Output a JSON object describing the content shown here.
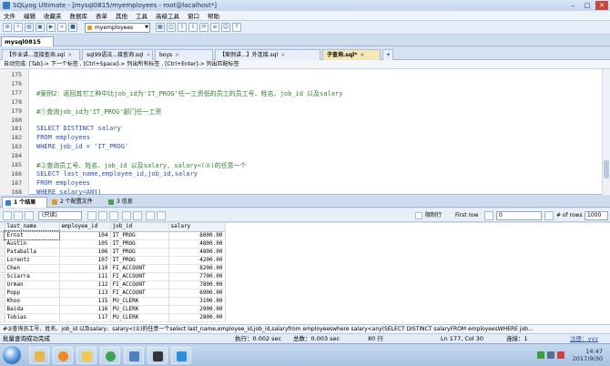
{
  "window": {
    "title": "SQLyog Ultimate - [mysql0815/myemployees - root@localhost*]"
  },
  "menu": [
    "文件",
    "编辑",
    "收藏夹",
    "数据库",
    "表单",
    "其他",
    "工具",
    "高级工具",
    "窗口",
    "帮助"
  ],
  "toolbar": {
    "database_select": "myemployees"
  },
  "connection_tab": "mysql0815",
  "query_tabs": [
    {
      "label": "【作业讲...连接查询.sql",
      "active": false
    },
    {
      "label": "sql99语法...接查询.sql",
      "active": false
    },
    {
      "label": "boys",
      "active": false
    },
    {
      "label": "【案例讲...】外连接.sql",
      "active": false
    },
    {
      "label": "子查询.sql*",
      "active": true
    }
  ],
  "hint": "自动完成: [Tab]-> 下一个标签 , [Ctrl+Space]-> 列出所有标签 , [Ctrl+Enter]-> 列出匹配标签",
  "editor": {
    "lines": [
      {
        "n": "175",
        "text": "",
        "cls": ""
      },
      {
        "n": "176",
        "text": "",
        "cls": ""
      },
      {
        "n": "177",
        "text": "#案例2：返回其它工种中比job_id为'IT_PROG'任一工资低的员工的员工号、姓名、job_id 以及salary",
        "cls": "cmt"
      },
      {
        "n": "178",
        "text": "",
        "cls": ""
      },
      {
        "n": "179",
        "text": "#①查询job_id为'IT_PROG'部门任一工资",
        "cls": "cmt"
      },
      {
        "n": "180",
        "text": "",
        "cls": ""
      },
      {
        "n": "181",
        "text": "SELECT DISTINCT salary",
        "cls": "kw"
      },
      {
        "n": "182",
        "text": "FROM employees",
        "cls": "kw"
      },
      {
        "n": "183",
        "text": "WHERE job_id = 'IT_PROG'",
        "cls": "kw"
      },
      {
        "n": "184",
        "text": "",
        "cls": ""
      },
      {
        "n": "185",
        "text": "#②查询员工号、姓名、job_id 以及salary, salary<(①)的任意一个",
        "cls": "cmt"
      },
      {
        "n": "186",
        "text": "SELECT last_name,employee_id,job_id,salary",
        "cls": "kw"
      },
      {
        "n": "187",
        "text": "FROM employees",
        "cls": "kw"
      },
      {
        "n": "188",
        "text": "WHERE salary<ANY(",
        "cls": "kw"
      }
    ]
  },
  "result_tabs": [
    {
      "label": "1 个结果",
      "active": true
    },
    {
      "label": "2 个配置文件",
      "active": false
    },
    {
      "label": "3 信息",
      "active": false
    }
  ],
  "grid_toolbar": {
    "mode": "(只读)",
    "limit_rows_label": "限制行",
    "first_row_label": "First row",
    "first_row_value": "0",
    "rows_label": "# of rows",
    "rows_value": "1000"
  },
  "grid": {
    "columns": [
      "last_name",
      "employee_id",
      "job_id",
      "salary"
    ],
    "rows": [
      [
        "Ernst",
        "104",
        "IT_PROG",
        "6000.00"
      ],
      [
        "Austin",
        "105",
        "IT_PROG",
        "4800.00"
      ],
      [
        "Pataballa",
        "106",
        "IT_PROG",
        "4800.00"
      ],
      [
        "Lorentz",
        "107",
        "IT_PROG",
        "4200.00"
      ],
      [
        "Chen",
        "110",
        "FI_ACCOUNT",
        "8200.00"
      ],
      [
        "Sciarra",
        "111",
        "FI_ACCOUNT",
        "7700.00"
      ],
      [
        "Urman",
        "112",
        "FI_ACCOUNT",
        "7800.00"
      ],
      [
        "Popp",
        "113",
        "FI_ACCOUNT",
        "6900.00"
      ],
      [
        "Khoo",
        "115",
        "PU_CLERK",
        "3100.00"
      ],
      [
        "Baida",
        "116",
        "PU_CLERK",
        "2900.00"
      ],
      [
        "Tobias",
        "117",
        "PU_CLERK",
        "2800.00"
      ]
    ]
  },
  "sql_status": "#②查询员工号、姓名、job_id 以及salary、salary<(①)的任意一个select last_name,employee_id,job_id,salaryfrom employeeswhere salary<any(SELECT DISTINCT salaryFROM employeesWHERE job...",
  "statusbar": {
    "left": "批量查询成功完成",
    "exec": "执行：0.002 sec",
    "total": "总数：0.003 sec",
    "rows": "80 行",
    "pos": "Ln 177, Col 30",
    "conn": "连接：1",
    "reg": "注册：yyy"
  },
  "taskbar": {
    "time": "14:47",
    "date": "2017/9/30"
  }
}
